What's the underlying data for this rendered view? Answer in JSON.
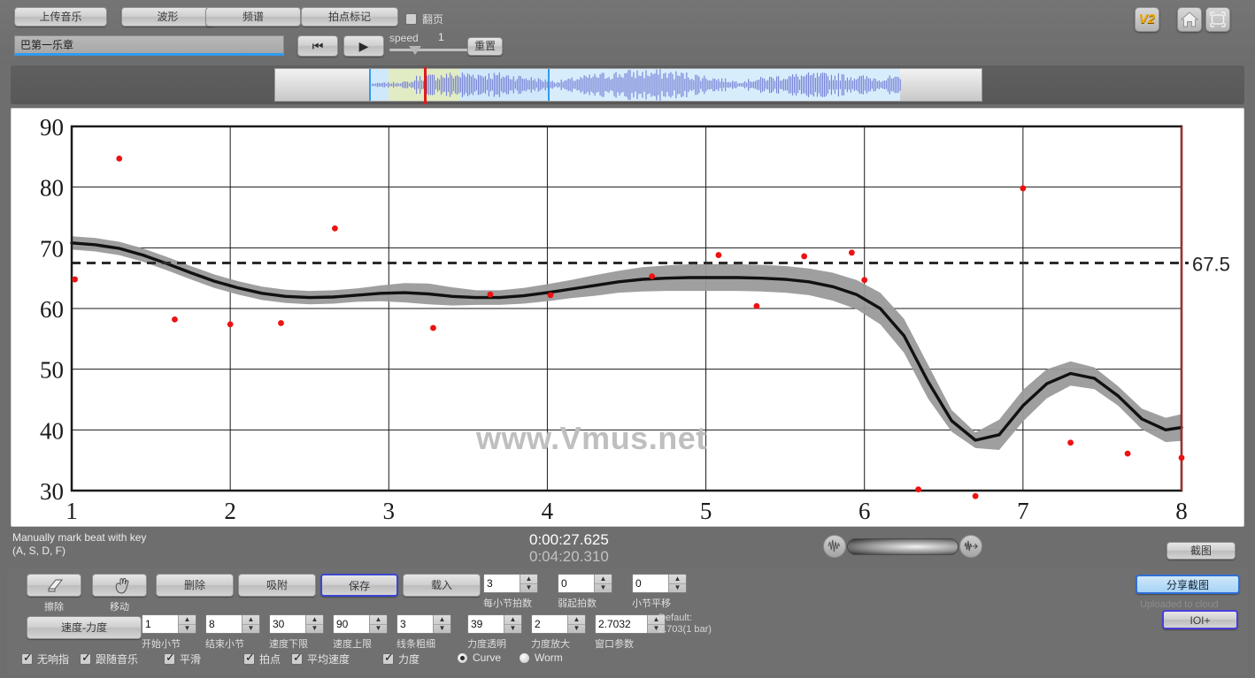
{
  "topbar": {
    "buttons": [
      {
        "id": "upload",
        "label": "上传音乐"
      },
      {
        "id": "waveform",
        "label": "波形"
      },
      {
        "id": "spectrum",
        "label": "频谱"
      },
      {
        "id": "beatmark",
        "label": "拍点标记"
      }
    ],
    "flip_checkbox": {
      "label": "翻页",
      "checked": false
    },
    "track_name": "巴第一乐章",
    "transport": {
      "prev": "⏮",
      "play": "▶"
    },
    "speed": {
      "label": "speed",
      "value": "1"
    },
    "reset_label": "重置",
    "icons": {
      "version": "V2",
      "home": "home-icon",
      "fullscreen": "fullscreen-icon"
    }
  },
  "chart_data": {
    "type": "line",
    "title": "",
    "xlabel": "",
    "ylabel": "",
    "xlim": [
      1,
      8
    ],
    "ylim": [
      30,
      90
    ],
    "xticks": [
      1,
      2,
      3,
      4,
      5,
      6,
      7,
      8
    ],
    "yticks": [
      30,
      40,
      50,
      60,
      70,
      80,
      90
    ],
    "grid": true,
    "mean_line": {
      "value": 67.5,
      "label": "67.5",
      "style": "dashed",
      "color": "#2b2b2b"
    },
    "watermark": "www.Vmus.net",
    "series": [
      {
        "name": "tempo-curve",
        "type": "line",
        "color": "#111111",
        "x": [
          1.0,
          1.15,
          1.3,
          1.45,
          1.6,
          1.75,
          1.9,
          2.05,
          2.2,
          2.35,
          2.5,
          2.65,
          2.8,
          2.95,
          3.1,
          3.25,
          3.4,
          3.55,
          3.7,
          3.85,
          4.0,
          4.15,
          4.3,
          4.45,
          4.6,
          4.75,
          4.9,
          5.05,
          5.2,
          5.35,
          5.5,
          5.65,
          5.8,
          5.95,
          6.1,
          6.25,
          6.4,
          6.55,
          6.7,
          6.85,
          7.0,
          7.15,
          7.3,
          7.45,
          7.6,
          7.75,
          7.9,
          8.0
        ],
        "y": [
          70.8,
          70.5,
          69.9,
          68.8,
          67.4,
          65.9,
          64.5,
          63.4,
          62.5,
          62.0,
          61.8,
          61.9,
          62.2,
          62.5,
          62.6,
          62.4,
          62.0,
          61.8,
          61.8,
          62.1,
          62.6,
          63.2,
          63.8,
          64.4,
          64.8,
          65.0,
          65.1,
          65.1,
          65.1,
          65.0,
          64.8,
          64.4,
          63.6,
          62.3,
          60.0,
          55.5,
          48.0,
          41.5,
          38.3,
          39.2,
          44.0,
          47.6,
          49.3,
          48.5,
          45.6,
          41.8,
          40.0,
          40.4
        ]
      },
      {
        "name": "confidence-band-upper",
        "type": "band",
        "color": "#9a9a9a",
        "y": [
          71.9,
          71.6,
          71.0,
          69.9,
          68.5,
          67.0,
          65.6,
          64.5,
          63.6,
          63.1,
          62.9,
          63.0,
          63.3,
          63.8,
          64.2,
          64.1,
          63.5,
          63.0,
          63.0,
          63.4,
          64.0,
          64.7,
          65.5,
          66.2,
          66.8,
          67.1,
          67.3,
          67.3,
          67.3,
          67.2,
          67.0,
          66.6,
          65.9,
          64.7,
          62.6,
          58.3,
          50.8,
          43.3,
          39.6,
          41.7,
          46.6,
          50.0,
          51.3,
          50.3,
          47.2,
          43.5,
          42.0,
          42.6
        ]
      },
      {
        "name": "confidence-band-lower",
        "type": "band",
        "color": "#9a9a9a",
        "y": [
          69.7,
          69.4,
          68.8,
          67.7,
          66.3,
          64.8,
          63.4,
          62.3,
          61.4,
          60.9,
          60.7,
          60.8,
          61.1,
          61.2,
          61.0,
          60.7,
          60.5,
          60.6,
          60.6,
          60.8,
          61.2,
          61.7,
          62.1,
          62.6,
          62.8,
          62.9,
          62.9,
          62.9,
          62.9,
          62.8,
          62.6,
          62.2,
          61.3,
          59.9,
          57.4,
          52.7,
          45.2,
          39.7,
          37.0,
          36.7,
          41.4,
          45.2,
          47.3,
          46.7,
          44.0,
          40.1,
          38.0,
          38.2
        ]
      }
    ],
    "scatter": {
      "name": "beat-points",
      "color": "#ee1111",
      "points": [
        [
          1.02,
          64.8
        ],
        [
          1.3,
          84.7
        ],
        [
          1.65,
          58.2
        ],
        [
          2.0,
          57.4
        ],
        [
          2.32,
          57.6
        ],
        [
          2.66,
          73.2
        ],
        [
          3.28,
          56.8
        ],
        [
          3.64,
          62.3
        ],
        [
          4.02,
          62.2
        ],
        [
          4.66,
          65.3
        ],
        [
          5.08,
          68.8
        ],
        [
          5.32,
          60.4
        ],
        [
          5.62,
          68.6
        ],
        [
          5.92,
          69.2
        ],
        [
          6.0,
          64.7
        ],
        [
          6.34,
          30.2
        ],
        [
          6.7,
          29.1
        ],
        [
          7.0,
          79.8
        ],
        [
          7.3,
          37.9
        ],
        [
          7.66,
          36.1
        ],
        [
          8.0,
          35.4
        ]
      ]
    }
  },
  "status": {
    "hint_line1": "Manually mark beat with key",
    "hint_line2": "(A, S, D, F)",
    "time_current": "0:00:27.625",
    "time_total": "0:04:20.310",
    "screenshot_label": "截图",
    "volume_icon_left": "waveform-icon",
    "volume_icon_right": "waveform-end-icon"
  },
  "bottom": {
    "tool_buttons": [
      {
        "id": "erase",
        "label": "擦除",
        "icon": "eraser-icon"
      },
      {
        "id": "move",
        "label": "移动",
        "icon": "hand-icon"
      }
    ],
    "action_buttons": [
      {
        "id": "delete",
        "label": "删除"
      },
      {
        "id": "snap",
        "label": "吸附"
      },
      {
        "id": "save",
        "label": "保存",
        "highlight": true
      },
      {
        "id": "load",
        "label": "载入"
      }
    ],
    "mode_button": {
      "id": "tempo-dynamics",
      "label": "速度-力度"
    },
    "spinners_row1": [
      {
        "id": "beats-per-bar",
        "value": "3",
        "label": "每小节拍数"
      },
      {
        "id": "pickup-beats",
        "value": "0",
        "label": "弱起拍数"
      },
      {
        "id": "bar-shift",
        "value": "0",
        "label": "小节平移"
      }
    ],
    "spinners_row2": [
      {
        "id": "start-bar",
        "value": "1",
        "label": "开始小节"
      },
      {
        "id": "end-bar",
        "value": "8",
        "label": "结束小节"
      },
      {
        "id": "tempo-min",
        "value": "30",
        "label": "速度下限"
      },
      {
        "id": "tempo-max",
        "value": "90",
        "label": "速度上限"
      },
      {
        "id": "line-width",
        "value": "3",
        "label": "线条粗细"
      },
      {
        "id": "dynamics-alpha",
        "value": "39",
        "label": "力度透明"
      },
      {
        "id": "dynamics-scale",
        "value": "2",
        "label": "力度放大"
      },
      {
        "id": "window-param",
        "value": "2.7032",
        "label": "窗口参数"
      }
    ],
    "default_note_line1": "Default:",
    "default_note_line2": "2.703(1 bar)",
    "checkboxes": [
      {
        "id": "no-snap-finger",
        "label": "无响指",
        "checked": true
      },
      {
        "id": "follow-music",
        "label": "跟随音乐",
        "checked": true
      },
      {
        "id": "smooth",
        "label": "平滑",
        "checked": true
      },
      {
        "id": "beats",
        "label": "拍点",
        "checked": true
      },
      {
        "id": "average-tempo",
        "label": "平均速度",
        "checked": true
      },
      {
        "id": "dynamics",
        "label": "力度",
        "checked": true
      }
    ],
    "radios": [
      {
        "id": "curve",
        "label": "Curve",
        "selected": true
      },
      {
        "id": "worm",
        "label": "Worm",
        "selected": false
      }
    ],
    "share_button": "分享截图",
    "cloud_note": "Uploaded to cloud",
    "ioi_button": "IOI+"
  }
}
